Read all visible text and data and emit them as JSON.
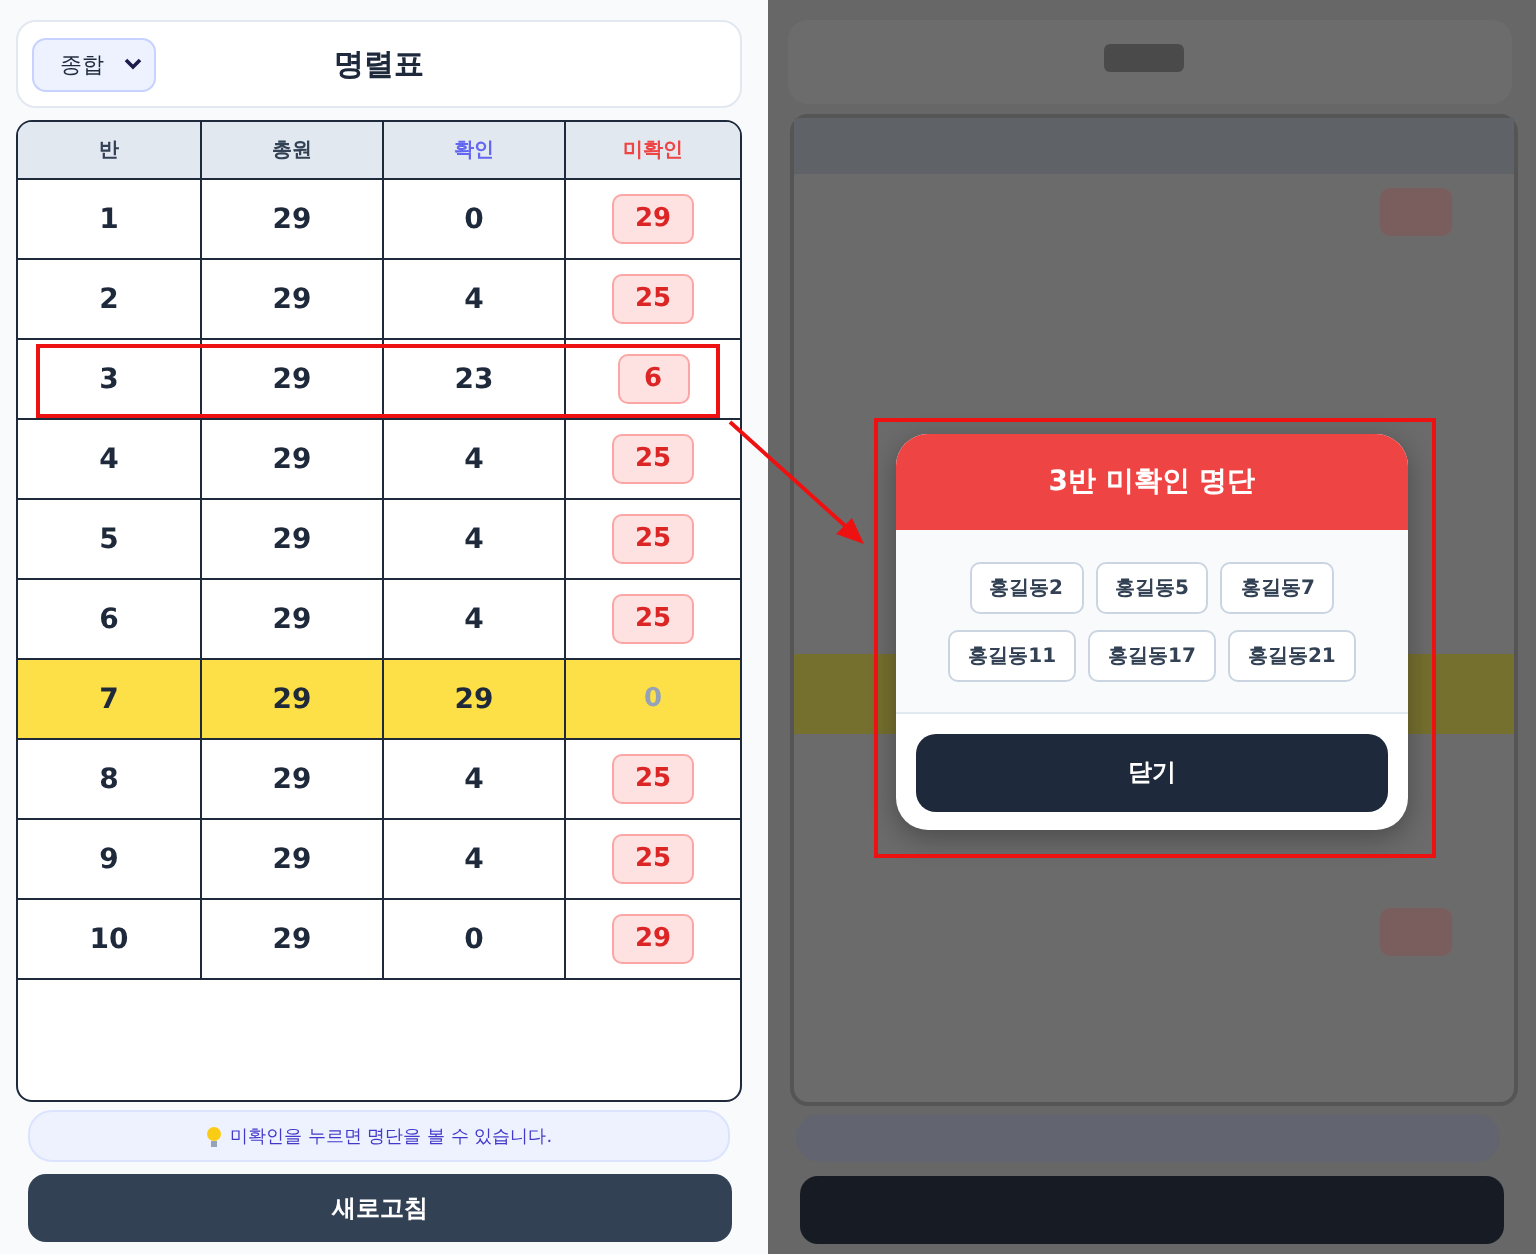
{
  "header": {
    "filter": {
      "value": "종합"
    },
    "title": "명렬표"
  },
  "table": {
    "columns": [
      "반",
      "총원",
      "확인",
      "미확인"
    ],
    "rows": [
      {
        "class": "1",
        "total": "29",
        "confirmed": "0",
        "unconfirmed": "29",
        "complete": false,
        "outlined": false
      },
      {
        "class": "2",
        "total": "29",
        "confirmed": "4",
        "unconfirmed": "25",
        "complete": false,
        "outlined": false
      },
      {
        "class": "3",
        "total": "29",
        "confirmed": "23",
        "unconfirmed": "6",
        "complete": false,
        "outlined": true
      },
      {
        "class": "4",
        "total": "29",
        "confirmed": "4",
        "unconfirmed": "25",
        "complete": false,
        "outlined": false
      },
      {
        "class": "5",
        "total": "29",
        "confirmed": "4",
        "unconfirmed": "25",
        "complete": false,
        "outlined": false
      },
      {
        "class": "6",
        "total": "29",
        "confirmed": "4",
        "unconfirmed": "25",
        "complete": false,
        "outlined": false
      },
      {
        "class": "7",
        "total": "29",
        "confirmed": "29",
        "unconfirmed": "0",
        "complete": true,
        "outlined": false
      },
      {
        "class": "8",
        "total": "29",
        "confirmed": "4",
        "unconfirmed": "25",
        "complete": false,
        "outlined": false
      },
      {
        "class": "9",
        "total": "29",
        "confirmed": "4",
        "unconfirmed": "25",
        "complete": false,
        "outlined": false
      },
      {
        "class": "10",
        "total": "29",
        "confirmed": "0",
        "unconfirmed": "29",
        "complete": false,
        "outlined": false
      }
    ]
  },
  "hint": "미확인을 누르면 명단을 볼 수 있습니다.",
  "refresh_button": "새로고침",
  "modal": {
    "title": "3반 미확인 명단",
    "names": [
      "홍길동2",
      "홍길동5",
      "홍길동7",
      "홍길동11",
      "홍길동17",
      "홍길동21"
    ],
    "close_button": "닫기"
  }
}
